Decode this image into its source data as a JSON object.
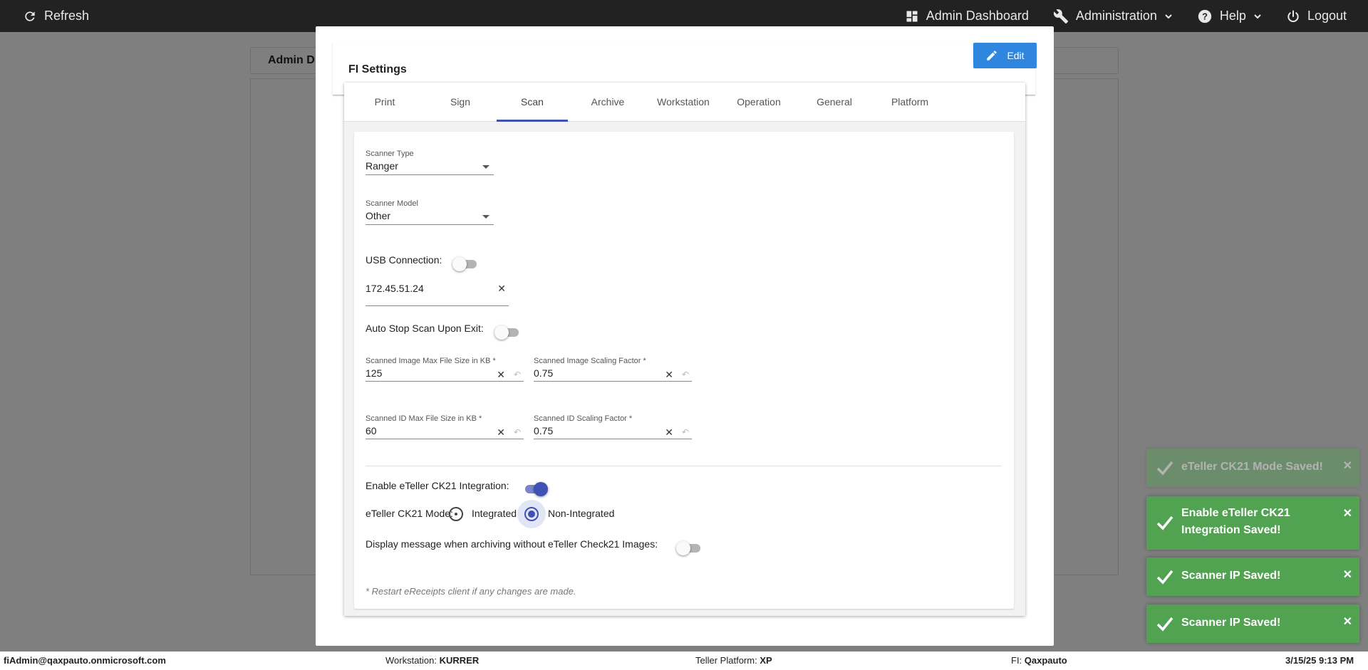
{
  "topbar": {
    "refresh_label": "Refresh",
    "admin_dashboard_label": "Admin Dashboard",
    "administration_label": "Administration",
    "help_label": "Help",
    "logout_label": "Logout"
  },
  "background_page": {
    "header_text": "Admin D"
  },
  "modal": {
    "title": "FI Settings",
    "edit_label": "Edit",
    "tabs": [
      "Print",
      "Sign",
      "Scan",
      "Archive",
      "Workstation",
      "Operation",
      "General",
      "Platform"
    ],
    "active_tab": "Scan",
    "scan": {
      "scanner_type": {
        "label": "Scanner Type",
        "value": "Ranger"
      },
      "scanner_model": {
        "label": "Scanner Model",
        "value": "Other"
      },
      "usb_connection": {
        "label": "USB Connection:",
        "on": false
      },
      "scanner_ip": {
        "value": "172.45.51.24"
      },
      "auto_stop": {
        "label": "Auto Stop Scan Upon Exit:",
        "on": false
      },
      "image_max_size": {
        "label": "Scanned Image Max File Size in KB *",
        "value": "125"
      },
      "image_scaling": {
        "label": "Scanned Image Scaling Factor *",
        "value": "0.75"
      },
      "id_max_size": {
        "label": "Scanned ID Max File Size in KB *",
        "value": "60"
      },
      "id_scaling": {
        "label": "Scanned ID Scaling Factor *",
        "value": "0.75"
      },
      "enable_ck21": {
        "label": "Enable eTeller CK21 Integration:",
        "on": true
      },
      "ck21_mode": {
        "label": "eTeller CK21 Mode:",
        "options": [
          "Integrated",
          "Non-Integrated"
        ],
        "selected": "Non-Integrated"
      },
      "display_message": {
        "label": "Display message when archiving without eTeller Check21 Images:",
        "on": false
      },
      "note": "* Restart eReceipts client if any changes are made."
    }
  },
  "toasts": [
    {
      "message": "eTeller CK21 Mode Saved!",
      "faded": true
    },
    {
      "message": "Enable eTeller CK21 Integration Saved!",
      "faded": false
    },
    {
      "message": "Scanner IP Saved!",
      "faded": false
    },
    {
      "message": "Scanner IP Saved!",
      "faded": false
    }
  ],
  "footer": {
    "user": "fiAdmin@qaxpauto.onmicrosoft.com",
    "workstation_label": "Workstation:",
    "workstation_value": "KURRER",
    "platform_label": "Teller Platform:",
    "platform_value": "XP",
    "fi_label": "FI:",
    "fi_value": "Qaxpauto",
    "datetime": "3/15/25 9:13 PM"
  },
  "colors": {
    "topbar": "#222222",
    "primary": "#3f51b5",
    "edit_button": "#2e86de",
    "toast_success": "#51a351"
  }
}
